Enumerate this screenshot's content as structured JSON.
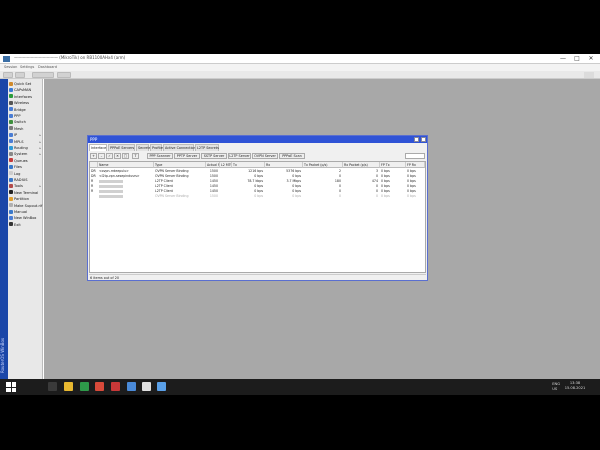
{
  "window": {
    "title": "——————————— (MikroTik) on RB1100AHx4 (arm)",
    "menu": [
      "Session",
      "Settings",
      "Dashboard"
    ],
    "controls": [
      "—",
      "□",
      "✕"
    ]
  },
  "sidebar": {
    "vertical_label": "RouterOS WinBox",
    "items": [
      {
        "label": "Quick Set",
        "icon_color": "#d08a2b",
        "has_arrow": false
      },
      {
        "label": "CAPsMAN",
        "icon_color": "#3a7bd5",
        "has_arrow": false
      },
      {
        "label": "Interfaces",
        "icon_color": "#2a9c3a",
        "has_arrow": false
      },
      {
        "label": "Wireless",
        "icon_color": "#555555",
        "has_arrow": false
      },
      {
        "label": "Bridge",
        "icon_color": "#4a7dd4",
        "has_arrow": false
      },
      {
        "label": "PPP",
        "icon_color": "#4a7dd4",
        "has_arrow": false
      },
      {
        "label": "Switch",
        "icon_color": "#3e8f3e",
        "has_arrow": false
      },
      {
        "label": "Mesh",
        "icon_color": "#7a7a7a",
        "has_arrow": false
      },
      {
        "label": "IP",
        "icon_color": "#4a7dd4",
        "has_arrow": true
      },
      {
        "label": "MPLS",
        "icon_color": "#4a7dd4",
        "has_arrow": true
      },
      {
        "label": "Routing",
        "icon_color": "#2f9ad8",
        "has_arrow": true
      },
      {
        "label": "System",
        "icon_color": "#888888",
        "has_arrow": true
      },
      {
        "label": "Queues",
        "icon_color": "#c63b3b",
        "has_arrow": false
      },
      {
        "label": "Files",
        "icon_color": "#3a78c9",
        "has_arrow": false
      },
      {
        "label": "Log",
        "icon_color": "#cccccc",
        "has_arrow": false
      },
      {
        "label": "RADIUS",
        "icon_color": "#3a78c9",
        "has_arrow": false
      },
      {
        "label": "Tools",
        "icon_color": "#b24a4a",
        "has_arrow": true
      },
      {
        "label": "New Terminal",
        "icon_color": "#222222",
        "has_arrow": false
      },
      {
        "label": "Partition",
        "icon_color": "#e0a030",
        "has_arrow": false
      },
      {
        "label": "Make Supout.rif",
        "icon_color": "#b0b0b0",
        "has_arrow": false
      },
      {
        "label": "Manual",
        "icon_color": "#3a78c9",
        "has_arrow": false
      },
      {
        "label": "New WinBox",
        "icon_color": "#4a7dd4",
        "has_arrow": false
      },
      {
        "label": "Exit",
        "icon_color": "#333333",
        "has_arrow": false
      }
    ]
  },
  "ppp_window": {
    "title": "PPP",
    "tabs": [
      "Interface",
      "PPPoE Servers",
      "Secrets",
      "Profiles",
      "Active Connections",
      "L2TP Secrets"
    ],
    "active_tab": 0,
    "toolbar_buttons": [
      "+",
      "–",
      "✓",
      "✕",
      "□",
      "T",
      "PPP Scanner",
      "PPTP Server",
      "SSTP Server",
      "L2TP Server",
      "OVPN Server",
      "PPPoE Scan"
    ],
    "find_placeholder": "Find",
    "columns": [
      "Name",
      "Type",
      "Actual MTU",
      "L2 MTU",
      "Tx",
      "Rx",
      "Tx Packet (p/s)",
      "Rx Packet (p/s)",
      "FP Tx",
      "FP Rx"
    ],
    "rows": [
      {
        "flag": "DR",
        "name": "<ovpn-rrdeepulu>",
        "type": "OVPN Server Binding",
        "mtu": "1500",
        "l2mtu": "",
        "tx": "1216 bps",
        "rx": "5376 bps",
        "txp": "2",
        "rxp": "3",
        "fptx": "0 bps",
        "fprx": "0 bps",
        "dim": false
      },
      {
        "flag": "DR",
        "name": "<l2tp-vpn-sesepindusrs>",
        "type": "OVPN Server Binding",
        "mtu": "1500",
        "l2mtu": "",
        "tx": "0 bps",
        "rx": "0 bps",
        "txp": "0",
        "rxp": "0",
        "fptx": "0 bps",
        "fprx": "0 bps",
        "dim": false
      },
      {
        "flag": "R",
        "name": "",
        "type": "L2TP Client",
        "mtu": "1450",
        "l2mtu": "",
        "tx": "78.7 kbps",
        "rx": "3.7 Mbps",
        "txp": "180",
        "rxp": "474",
        "fptx": "0 bps",
        "fprx": "0 bps",
        "dim": false
      },
      {
        "flag": "R",
        "name": "",
        "type": "L2TP Client",
        "mtu": "1450",
        "l2mtu": "",
        "tx": "0 bps",
        "rx": "0 bps",
        "txp": "0",
        "rxp": "0",
        "fptx": "0 bps",
        "fprx": "0 bps",
        "dim": false
      },
      {
        "flag": "R",
        "name": "",
        "type": "L2TP Client",
        "mtu": "1450",
        "l2mtu": "",
        "tx": "0 bps",
        "rx": "0 bps",
        "txp": "0",
        "rxp": "0",
        "fptx": "0 bps",
        "fprx": "0 bps",
        "dim": false
      },
      {
        "flag": "",
        "name": "",
        "type": "OVPN Server Binding",
        "mtu": "1500",
        "l2mtu": "",
        "tx": "0 bps",
        "rx": "0 bps",
        "txp": "0",
        "rxp": "0",
        "fptx": "0 bps",
        "fprx": "0 bps",
        "dim": true
      }
    ],
    "status": "6 items out of 20"
  },
  "taskbar": {
    "icons": [
      {
        "name": "search",
        "color": "#3a3a3a"
      },
      {
        "name": "file-explorer",
        "color": "#e8b830"
      },
      {
        "name": "app-green",
        "color": "#2e9a4a"
      },
      {
        "name": "chrome",
        "color": "#d84a3a"
      },
      {
        "name": "app-red",
        "color": "#c83838"
      },
      {
        "name": "app-blue",
        "color": "#4a8ad8"
      },
      {
        "name": "winbox",
        "color": "#e0e0e0"
      },
      {
        "name": "app-lightblue",
        "color": "#5aa0e8"
      }
    ],
    "language_top": "ENG",
    "language_bottom": "US",
    "time": "13:38",
    "date": "15.08.2021"
  }
}
